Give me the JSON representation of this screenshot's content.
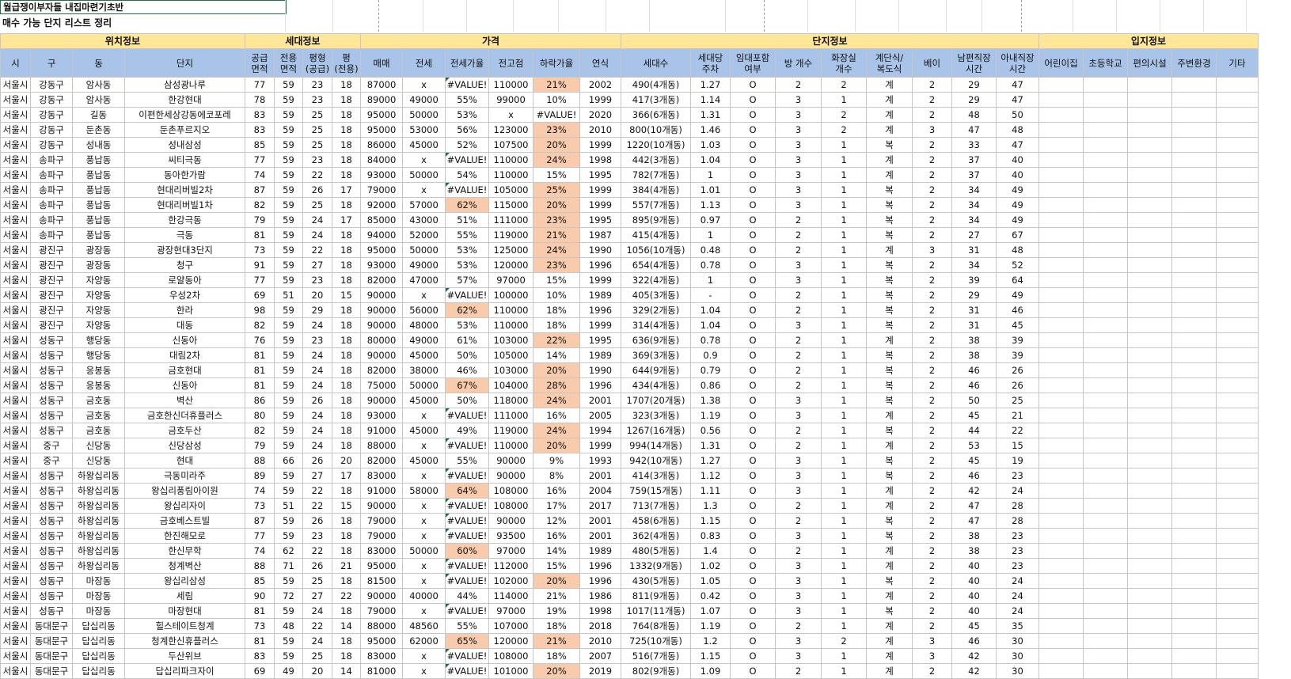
{
  "sheet": {
    "title": "월급쟁이부자들 내집마련기초반",
    "subtitle": "매수 가능 단지 리스트 정리"
  },
  "groups": [
    {
      "label": "위치정보",
      "span": 4
    },
    {
      "label": "세대정보",
      "span": 4
    },
    {
      "label": "가격",
      "span": 6
    },
    {
      "label": "단지정보",
      "span": 9
    },
    {
      "label": "입지정보",
      "span": 7
    }
  ],
  "columns": [
    "시",
    "구",
    "동",
    "단지",
    "공급\n면적",
    "전용\n면적",
    "평형\n(공급)",
    "평\n(전용)",
    "매매",
    "전세",
    "전세가율",
    "전고점",
    "하락가율",
    "연식",
    "세대수",
    "세대당\n주차",
    "임대포함\n여부",
    "방 개수",
    "화장실\n개수",
    "계단식/\n복도식",
    "베이",
    "남편직장\n시간",
    "아내직장\n시간",
    "어린이집",
    "초등학교",
    "편의시설",
    "주변환경",
    "기타"
  ],
  "highlight_color": "#f8cbad",
  "rows": [
    [
      "서울시",
      "강동구",
      "암사동",
      "삼성광나루",
      "77",
      "59",
      "23",
      "18",
      "87000",
      "x",
      "#VALUE!",
      "110000",
      "21%",
      "2002",
      "490(4개동)",
      "1.27",
      "O",
      "2",
      "2",
      "계",
      "2",
      "29",
      "47",
      "",
      "",
      "",
      "",
      ""
    ],
    [
      "서울시",
      "강동구",
      "암사동",
      "한강현대",
      "78",
      "59",
      "23",
      "18",
      "89000",
      "49000",
      "55%",
      "99000",
      "10%",
      "1999",
      "417(3개동)",
      "1.14",
      "O",
      "3",
      "1",
      "계",
      "2",
      "29",
      "47",
      "",
      "",
      "",
      "",
      ""
    ],
    [
      "서울시",
      "강동구",
      "길동",
      "이편한세상강동에코포레",
      "83",
      "59",
      "25",
      "18",
      "95000",
      "50000",
      "53%",
      "x",
      "#VALUE!",
      "2020",
      "366(6개동)",
      "1.31",
      "O",
      "3",
      "2",
      "계",
      "2",
      "48",
      "50",
      "",
      "",
      "",
      "",
      ""
    ],
    [
      "서울시",
      "강동구",
      "둔촌동",
      "둔촌푸르지오",
      "83",
      "59",
      "25",
      "18",
      "95000",
      "53000",
      "56%",
      "123000",
      "23%",
      "2010",
      "800(10개동)",
      "1.46",
      "O",
      "3",
      "2",
      "계",
      "3",
      "47",
      "48",
      "",
      "",
      "",
      "",
      ""
    ],
    [
      "서울시",
      "강동구",
      "성내동",
      "성내삼성",
      "85",
      "59",
      "25",
      "18",
      "86000",
      "45000",
      "52%",
      "107500",
      "20%",
      "1999",
      "1220(10개동)",
      "1.03",
      "O",
      "3",
      "1",
      "복",
      "2",
      "33",
      "47",
      "",
      "",
      "",
      "",
      ""
    ],
    [
      "서울시",
      "송파구",
      "풍납동",
      "씨티극동",
      "77",
      "59",
      "23",
      "18",
      "84000",
      "x",
      "#VALUE!",
      "110000",
      "24%",
      "1998",
      "442(3개동)",
      "1.04",
      "O",
      "3",
      "1",
      "계",
      "2",
      "37",
      "40",
      "",
      "",
      "",
      "",
      ""
    ],
    [
      "서울시",
      "송파구",
      "풍납동",
      "동아한가람",
      "74",
      "59",
      "22",
      "18",
      "93000",
      "50000",
      "54%",
      "110000",
      "15%",
      "1995",
      "782(7개동)",
      "1",
      "O",
      "3",
      "1",
      "계",
      "2",
      "37",
      "40",
      "",
      "",
      "",
      "",
      ""
    ],
    [
      "서울시",
      "송파구",
      "풍납동",
      "현대리버빌2차",
      "87",
      "59",
      "26",
      "17",
      "79000",
      "x",
      "#VALUE!",
      "105000",
      "25%",
      "1999",
      "384(4개동)",
      "1.01",
      "O",
      "3",
      "1",
      "복",
      "2",
      "34",
      "49",
      "",
      "",
      "",
      "",
      ""
    ],
    [
      "서울시",
      "송파구",
      "풍납동",
      "현대리버빌1차",
      "82",
      "59",
      "25",
      "18",
      "92000",
      "57000",
      "62%",
      "115000",
      "20%",
      "1999",
      "557(7개동)",
      "1.13",
      "O",
      "3",
      "1",
      "복",
      "2",
      "34",
      "49",
      "",
      "",
      "",
      "",
      ""
    ],
    [
      "서울시",
      "송파구",
      "풍납동",
      "한강극동",
      "79",
      "59",
      "24",
      "17",
      "85000",
      "43000",
      "51%",
      "111000",
      "23%",
      "1995",
      "895(9개동)",
      "0.97",
      "O",
      "2",
      "1",
      "복",
      "2",
      "34",
      "49",
      "",
      "",
      "",
      "",
      ""
    ],
    [
      "서울시",
      "송파구",
      "풍납동",
      "극동",
      "81",
      "59",
      "24",
      "18",
      "94000",
      "52000",
      "55%",
      "119000",
      "21%",
      "1987",
      "415(4개동)",
      "1",
      "O",
      "2",
      "1",
      "복",
      "2",
      "27",
      "67",
      "",
      "",
      "",
      "",
      ""
    ],
    [
      "서울시",
      "광진구",
      "광장동",
      "광장현대3단지",
      "73",
      "59",
      "22",
      "18",
      "95000",
      "50000",
      "53%",
      "125000",
      "24%",
      "1990",
      "1056(10개동)",
      "0.48",
      "O",
      "2",
      "1",
      "계",
      "3",
      "31",
      "48",
      "",
      "",
      "",
      "",
      ""
    ],
    [
      "서울시",
      "광진구",
      "광장동",
      "청구",
      "91",
      "59",
      "27",
      "18",
      "93000",
      "49000",
      "53%",
      "120000",
      "23%",
      "1996",
      "654(4개동)",
      "0.78",
      "O",
      "3",
      "1",
      "복",
      "2",
      "34",
      "52",
      "",
      "",
      "",
      "",
      ""
    ],
    [
      "서울시",
      "광진구",
      "자양동",
      "로얄동아",
      "77",
      "59",
      "23",
      "18",
      "82000",
      "47000",
      "57%",
      "97000",
      "15%",
      "1999",
      "322(4개동)",
      "1",
      "O",
      "3",
      "1",
      "복",
      "2",
      "39",
      "64",
      "",
      "",
      "",
      "",
      ""
    ],
    [
      "서울시",
      "광진구",
      "자양동",
      "우성2차",
      "69",
      "51",
      "20",
      "15",
      "90000",
      "x",
      "#VALUE!",
      "100000",
      "10%",
      "1989",
      "405(3개동)",
      "-",
      "O",
      "2",
      "1",
      "복",
      "2",
      "29",
      "49",
      "",
      "",
      "",
      "",
      ""
    ],
    [
      "서울시",
      "광진구",
      "자양동",
      "한라",
      "98",
      "59",
      "29",
      "18",
      "90000",
      "56000",
      "62%",
      "110000",
      "18%",
      "1996",
      "329(2개동)",
      "1.04",
      "O",
      "2",
      "1",
      "복",
      "2",
      "31",
      "46",
      "",
      "",
      "",
      "",
      ""
    ],
    [
      "서울시",
      "광진구",
      "자양동",
      "대동",
      "82",
      "59",
      "24",
      "18",
      "90000",
      "48000",
      "53%",
      "110000",
      "18%",
      "1999",
      "314(4개동)",
      "1.04",
      "O",
      "3",
      "1",
      "복",
      "2",
      "31",
      "45",
      "",
      "",
      "",
      "",
      ""
    ],
    [
      "서울시",
      "성동구",
      "행당동",
      "신동아",
      "76",
      "59",
      "23",
      "18",
      "80000",
      "49000",
      "61%",
      "103000",
      "22%",
      "1995",
      "636(9개동)",
      "0.78",
      "O",
      "2",
      "1",
      "계",
      "2",
      "38",
      "39",
      "",
      "",
      "",
      "",
      ""
    ],
    [
      "서울시",
      "성동구",
      "행당동",
      "대림2차",
      "81",
      "59",
      "24",
      "18",
      "90000",
      "45000",
      "50%",
      "105000",
      "14%",
      "1989",
      "369(3개동)",
      "0.9",
      "O",
      "2",
      "1",
      "복",
      "2",
      "38",
      "39",
      "",
      "",
      "",
      "",
      ""
    ],
    [
      "서울시",
      "성동구",
      "응봉동",
      "금호현대",
      "81",
      "59",
      "24",
      "18",
      "82000",
      "38000",
      "46%",
      "103000",
      "20%",
      "1990",
      "644(9개동)",
      "0.79",
      "O",
      "2",
      "1",
      "복",
      "2",
      "46",
      "26",
      "",
      "",
      "",
      "",
      ""
    ],
    [
      "서울시",
      "성동구",
      "응봉동",
      "신동아",
      "81",
      "59",
      "24",
      "18",
      "75000",
      "50000",
      "67%",
      "104000",
      "28%",
      "1996",
      "434(4개동)",
      "0.86",
      "O",
      "2",
      "1",
      "복",
      "2",
      "46",
      "26",
      "",
      "",
      "",
      "",
      ""
    ],
    [
      "서울시",
      "성동구",
      "금호동",
      "벽산",
      "86",
      "59",
      "26",
      "18",
      "90000",
      "45000",
      "50%",
      "118000",
      "24%",
      "2001",
      "1707(20개동)",
      "1.38",
      "O",
      "3",
      "1",
      "복",
      "2",
      "50",
      "25",
      "",
      "",
      "",
      "",
      ""
    ],
    [
      "서울시",
      "성동구",
      "금호동",
      "금호한신더휴플러스",
      "80",
      "59",
      "24",
      "18",
      "93000",
      "x",
      "#VALUE!",
      "111000",
      "16%",
      "2005",
      "323(3개동)",
      "1.19",
      "O",
      "3",
      "1",
      "계",
      "2",
      "45",
      "21",
      "",
      "",
      "",
      "",
      ""
    ],
    [
      "서울시",
      "성동구",
      "금호동",
      "금호두산",
      "82",
      "59",
      "24",
      "18",
      "91000",
      "45000",
      "49%",
      "119000",
      "24%",
      "1994",
      "1267(16개동)",
      "0.56",
      "O",
      "2",
      "1",
      "복",
      "2",
      "44",
      "22",
      "",
      "",
      "",
      "",
      ""
    ],
    [
      "서울시",
      "중구",
      "신당동",
      "신당삼성",
      "79",
      "59",
      "24",
      "18",
      "88000",
      "x",
      "#VALUE!",
      "110000",
      "20%",
      "1999",
      "994(14개동)",
      "1.31",
      "O",
      "2",
      "1",
      "계",
      "2",
      "53",
      "15",
      "",
      "",
      "",
      "",
      ""
    ],
    [
      "서울시",
      "중구",
      "신당동",
      "현대",
      "88",
      "66",
      "26",
      "20",
      "82000",
      "45000",
      "55%",
      "90000",
      "9%",
      "1993",
      "942(10개동)",
      "1.27",
      "O",
      "3",
      "1",
      "복",
      "2",
      "45",
      "19",
      "",
      "",
      "",
      "",
      ""
    ],
    [
      "서울시",
      "성동구",
      "하왕십리동",
      "극동미라주",
      "89",
      "59",
      "27",
      "17",
      "83000",
      "x",
      "#VALUE!",
      "90000",
      "8%",
      "2001",
      "414(3개동)",
      "1.12",
      "O",
      "3",
      "1",
      "복",
      "2",
      "46",
      "23",
      "",
      "",
      "",
      "",
      ""
    ],
    [
      "서울시",
      "성동구",
      "하왕십리동",
      "왕십리풍림아이원",
      "74",
      "59",
      "22",
      "18",
      "91000",
      "58000",
      "64%",
      "108000",
      "16%",
      "2004",
      "759(15개동)",
      "1.11",
      "O",
      "3",
      "1",
      "계",
      "2",
      "42",
      "24",
      "",
      "",
      "",
      "",
      ""
    ],
    [
      "서울시",
      "성동구",
      "하왕십리동",
      "왕십리자이",
      "73",
      "51",
      "22",
      "15",
      "90000",
      "x",
      "#VALUE!",
      "108000",
      "17%",
      "2017",
      "713(7개동)",
      "1.3",
      "O",
      "2",
      "1",
      "계",
      "2",
      "47",
      "28",
      "",
      "",
      "",
      "",
      ""
    ],
    [
      "서울시",
      "성동구",
      "하왕십리동",
      "금호베스트빌",
      "87",
      "59",
      "26",
      "18",
      "79000",
      "x",
      "#VALUE!",
      "90000",
      "12%",
      "2001",
      "458(6개동)",
      "1.15",
      "O",
      "2",
      "1",
      "복",
      "2",
      "47",
      "28",
      "",
      "",
      "",
      "",
      ""
    ],
    [
      "서울시",
      "성동구",
      "하왕십리동",
      "한진해모로",
      "77",
      "59",
      "23",
      "18",
      "79000",
      "x",
      "#VALUE!",
      "93500",
      "16%",
      "2001",
      "362(4개동)",
      "0.83",
      "O",
      "3",
      "1",
      "복",
      "2",
      "38",
      "23",
      "",
      "",
      "",
      "",
      ""
    ],
    [
      "서울시",
      "성동구",
      "하왕십리동",
      "한신무학",
      "74",
      "62",
      "22",
      "18",
      "83000",
      "50000",
      "60%",
      "97000",
      "14%",
      "1989",
      "480(5개동)",
      "1.4",
      "O",
      "2",
      "1",
      "계",
      "2",
      "38",
      "23",
      "",
      "",
      "",
      "",
      ""
    ],
    [
      "서울시",
      "성동구",
      "하왕십리동",
      "청계벽산",
      "88",
      "71",
      "26",
      "21",
      "95000",
      "x",
      "#VALUE!",
      "112000",
      "15%",
      "1996",
      "1332(9개동)",
      "1.02",
      "O",
      "3",
      "1",
      "계",
      "2",
      "40",
      "23",
      "",
      "",
      "",
      "",
      ""
    ],
    [
      "서울시",
      "성동구",
      "마장동",
      "왕십리삼성",
      "85",
      "59",
      "25",
      "18",
      "81500",
      "x",
      "#VALUE!",
      "102000",
      "20%",
      "1996",
      "430(5개동)",
      "1.05",
      "O",
      "3",
      "1",
      "복",
      "2",
      "40",
      "24",
      "",
      "",
      "",
      "",
      ""
    ],
    [
      "서울시",
      "성동구",
      "마장동",
      "세림",
      "90",
      "72",
      "27",
      "22",
      "90000",
      "40000",
      "44%",
      "114000",
      "21%",
      "1986",
      "811(9개동)",
      "0.42",
      "O",
      "3",
      "1",
      "계",
      "2",
      "40",
      "24",
      "",
      "",
      "",
      "",
      ""
    ],
    [
      "서울시",
      "성동구",
      "마장동",
      "마장현대",
      "81",
      "59",
      "24",
      "18",
      "79000",
      "x",
      "#VALUE!",
      "97000",
      "19%",
      "1998",
      "1017(11개동)",
      "1.07",
      "O",
      "3",
      "1",
      "복",
      "2",
      "40",
      "24",
      "",
      "",
      "",
      "",
      ""
    ],
    [
      "서울시",
      "동대문구",
      "답십리동",
      "힐스테이트청계",
      "73",
      "48",
      "22",
      "14",
      "88000",
      "48560",
      "55%",
      "107000",
      "18%",
      "2018",
      "764(8개동)",
      "1.19",
      "O",
      "2",
      "1",
      "계",
      "2",
      "45",
      "35",
      "",
      "",
      "",
      "",
      ""
    ],
    [
      "서울시",
      "동대문구",
      "답십리동",
      "청계한신휴플러스",
      "81",
      "59",
      "24",
      "18",
      "95000",
      "62000",
      "65%",
      "120000",
      "21%",
      "2010",
      "725(10개동)",
      "1.2",
      "O",
      "3",
      "2",
      "계",
      "3",
      "46",
      "30",
      "",
      "",
      "",
      "",
      ""
    ],
    [
      "서울시",
      "동대문구",
      "답십리동",
      "두산위브",
      "83",
      "59",
      "25",
      "18",
      "83000",
      "x",
      "#VALUE!",
      "108000",
      "18%",
      "2007",
      "516(7개동)",
      "1.15",
      "O",
      "3",
      "1",
      "계",
      "3",
      "42",
      "30",
      "",
      "",
      "",
      "",
      ""
    ],
    [
      "서울시",
      "동대문구",
      "답십리동",
      "답십리파크자이",
      "69",
      "49",
      "20",
      "14",
      "81000",
      "x",
      "#VALUE!",
      "101000",
      "20%",
      "2019",
      "802(9개동)",
      "1.09",
      "O",
      "2",
      "1",
      "계",
      "2",
      "42",
      "30",
      "",
      "",
      "",
      "",
      ""
    ]
  ],
  "highlights": [
    [
      0,
      12
    ],
    [
      3,
      12
    ],
    [
      4,
      12
    ],
    [
      5,
      12
    ],
    [
      7,
      12
    ],
    [
      8,
      10
    ],
    [
      8,
      12
    ],
    [
      9,
      12
    ],
    [
      10,
      12
    ],
    [
      11,
      12
    ],
    [
      12,
      12
    ],
    [
      15,
      10
    ],
    [
      17,
      12
    ],
    [
      19,
      12
    ],
    [
      20,
      10
    ],
    [
      20,
      12
    ],
    [
      21,
      12
    ],
    [
      23,
      12
    ],
    [
      24,
      12
    ],
    [
      27,
      10
    ],
    [
      31,
      10
    ],
    [
      33,
      12
    ],
    [
      37,
      10
    ],
    [
      37,
      12
    ],
    [
      39,
      12
    ]
  ]
}
